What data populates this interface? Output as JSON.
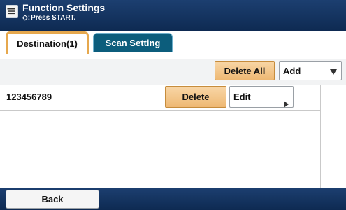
{
  "header": {
    "title": "Function Settings",
    "subtitle": "Press START.",
    "start_glyph": "◇:"
  },
  "tabs": [
    {
      "label": "Destination(1)",
      "selected": true
    },
    {
      "label": "Scan Setting",
      "selected": false
    }
  ],
  "toolbar": {
    "delete_all_label": "Delete All",
    "add_label": "Add"
  },
  "destinations": [
    {
      "value": "123456789",
      "delete_label": "Delete",
      "edit_label": "Edit"
    }
  ],
  "footer": {
    "back_label": "Back"
  },
  "colors": {
    "header_bg": "#1c3f70",
    "tab_active_border": "#e6a84d",
    "tab_inactive_bg": "#0c5d7c",
    "orange_button": "#eeb873"
  }
}
